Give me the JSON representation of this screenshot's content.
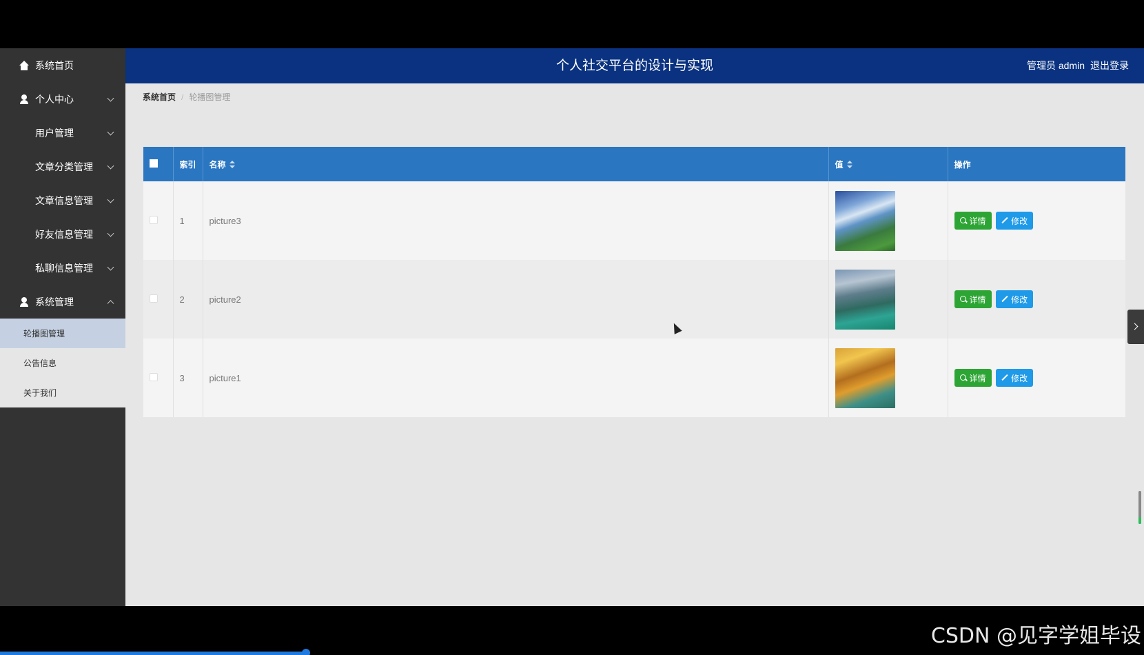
{
  "header": {
    "title": "个人社交平台的设计与实现",
    "user_role": "管理员 admin",
    "logout": "退出登录"
  },
  "sidebar": {
    "items": [
      {
        "label": "系统首页",
        "icon": "home-icon"
      },
      {
        "label": "个人中心",
        "icon": "user-icon"
      },
      {
        "label": "用户管理",
        "icon": "grid-icon"
      },
      {
        "label": "文章分类管理",
        "icon": "grid-icon"
      },
      {
        "label": "文章信息管理",
        "icon": "grid-icon"
      },
      {
        "label": "好友信息管理",
        "icon": "grid-icon"
      },
      {
        "label": "私聊信息管理",
        "icon": "grid-icon"
      },
      {
        "label": "系统管理",
        "icon": "user-icon"
      }
    ],
    "submenu": [
      {
        "label": "轮播图管理",
        "active": true
      },
      {
        "label": "公告信息",
        "active": false
      },
      {
        "label": "关于我们",
        "active": false
      }
    ]
  },
  "breadcrumb": {
    "home": "系统首页",
    "separator": "/",
    "current": "轮播图管理"
  },
  "table": {
    "columns": {
      "index": "索引",
      "name": "名称",
      "value": "值",
      "actions": "操作"
    },
    "rows": [
      {
        "index": "1",
        "name": "picture3"
      },
      {
        "index": "2",
        "name": "picture2"
      },
      {
        "index": "3",
        "name": "picture1"
      }
    ],
    "detail_label": "详情",
    "edit_label": "修改"
  },
  "watermark": "CSDN @见字学姐毕设",
  "colors": {
    "header_bg": "#0a3280",
    "sidebar_bg": "#333333",
    "table_header_bg": "#2a76c1",
    "detail_button": "#2da534",
    "edit_button": "#1f9ae8"
  }
}
